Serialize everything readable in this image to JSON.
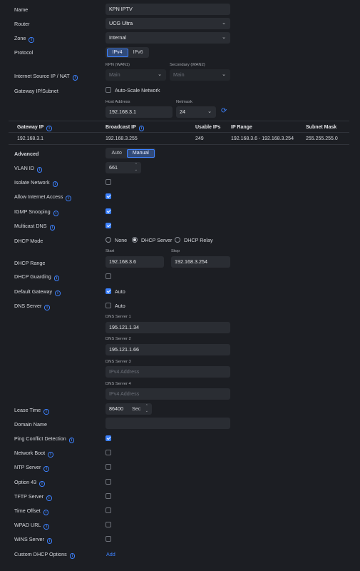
{
  "name": {
    "label": "Name",
    "value": "KPN IPTV"
  },
  "router": {
    "label": "Router",
    "value": "UCG Ultra"
  },
  "zone": {
    "label": "Zone",
    "value": "Internal"
  },
  "protocol": {
    "label": "Protocol",
    "options": [
      "IPv4",
      "IPv6"
    ],
    "selected": "IPv4"
  },
  "internet_source": {
    "label": "Internet Source IP / NAT",
    "primary_label": "KPN (WAN1)",
    "primary_value": "Main",
    "secondary_label": "Secondary (WAN2)",
    "secondary_value": "Main"
  },
  "gateway_subnet": {
    "label": "Gateway IP/Subnet",
    "auto_scale_label": "Auto-Scale Network",
    "auto_scale_checked": false,
    "host_label": "Host Address",
    "host_value": "192.168.3.1",
    "netmask_label": "Netmask",
    "netmask_value": "24"
  },
  "table": {
    "headers": [
      "Gateway IP",
      "Broadcast IP",
      "Usable IPs",
      "IP Range",
      "Subnet Mask"
    ],
    "row": [
      "192.168.3.1",
      "192.168.3.255",
      "249",
      "192.168.3.6 - 192.168.3.254",
      "255.255.255.0"
    ]
  },
  "advanced": {
    "label": "Advanced",
    "options": [
      "Auto",
      "Manual"
    ],
    "selected": "Manual"
  },
  "vlan": {
    "label": "VLAN ID",
    "value": "661"
  },
  "isolate": {
    "label": "Isolate Network",
    "checked": false
  },
  "allow_internet": {
    "label": "Allow Internet Access",
    "checked": true
  },
  "igmp": {
    "label": "IGMP Snooping",
    "checked": true
  },
  "mdns": {
    "label": "Multicast DNS",
    "checked": true
  },
  "dhcp_mode": {
    "label": "DHCP Mode",
    "options": [
      "None",
      "DHCP Server",
      "DHCP Relay"
    ],
    "selected": "DHCP Server"
  },
  "dhcp_range": {
    "label": "DHCP Range",
    "start_label": "Start",
    "start_value": "192.168.3.6",
    "stop_label": "Stop",
    "stop_value": "192.168.3.254"
  },
  "dhcp_guarding": {
    "label": "DHCP Guarding",
    "checked": false
  },
  "default_gateway": {
    "label": "Default Gateway",
    "checked": true,
    "auto_label": "Auto"
  },
  "dns_server": {
    "label": "DNS Server",
    "checked": false,
    "auto_label": "Auto",
    "servers": [
      {
        "label": "DNS Server 1",
        "value": "195.121.1.34",
        "placeholder": ""
      },
      {
        "label": "DNS Server 2",
        "value": "195.121.1.66",
        "placeholder": ""
      },
      {
        "label": "DNS Server 3",
        "value": "",
        "placeholder": "IPv4 Address"
      },
      {
        "label": "DNS Server 4",
        "value": "",
        "placeholder": "IPv4 Address"
      }
    ]
  },
  "lease_time": {
    "label": "Lease Time",
    "value": "86400",
    "unit": "Sec"
  },
  "domain_name": {
    "label": "Domain Name",
    "value": ""
  },
  "ping_conflict": {
    "label": "Ping Conflict Detection",
    "checked": true
  },
  "network_boot": {
    "label": "Network Boot",
    "checked": false
  },
  "ntp": {
    "label": "NTP Server",
    "checked": false
  },
  "option43": {
    "label": "Option 43",
    "checked": false
  },
  "tftp": {
    "label": "TFTP Server",
    "checked": false
  },
  "time_offset": {
    "label": "Time Offset",
    "checked": false
  },
  "wpad": {
    "label": "WPAD URL",
    "checked": false
  },
  "wins": {
    "label": "WINS Server",
    "checked": false
  },
  "custom_dhcp": {
    "label": "Custom DHCP Options",
    "add_label": "Add"
  },
  "colors": {
    "background": "#1c1e23",
    "accent": "#3d82ff",
    "input": "#2a2d33"
  }
}
